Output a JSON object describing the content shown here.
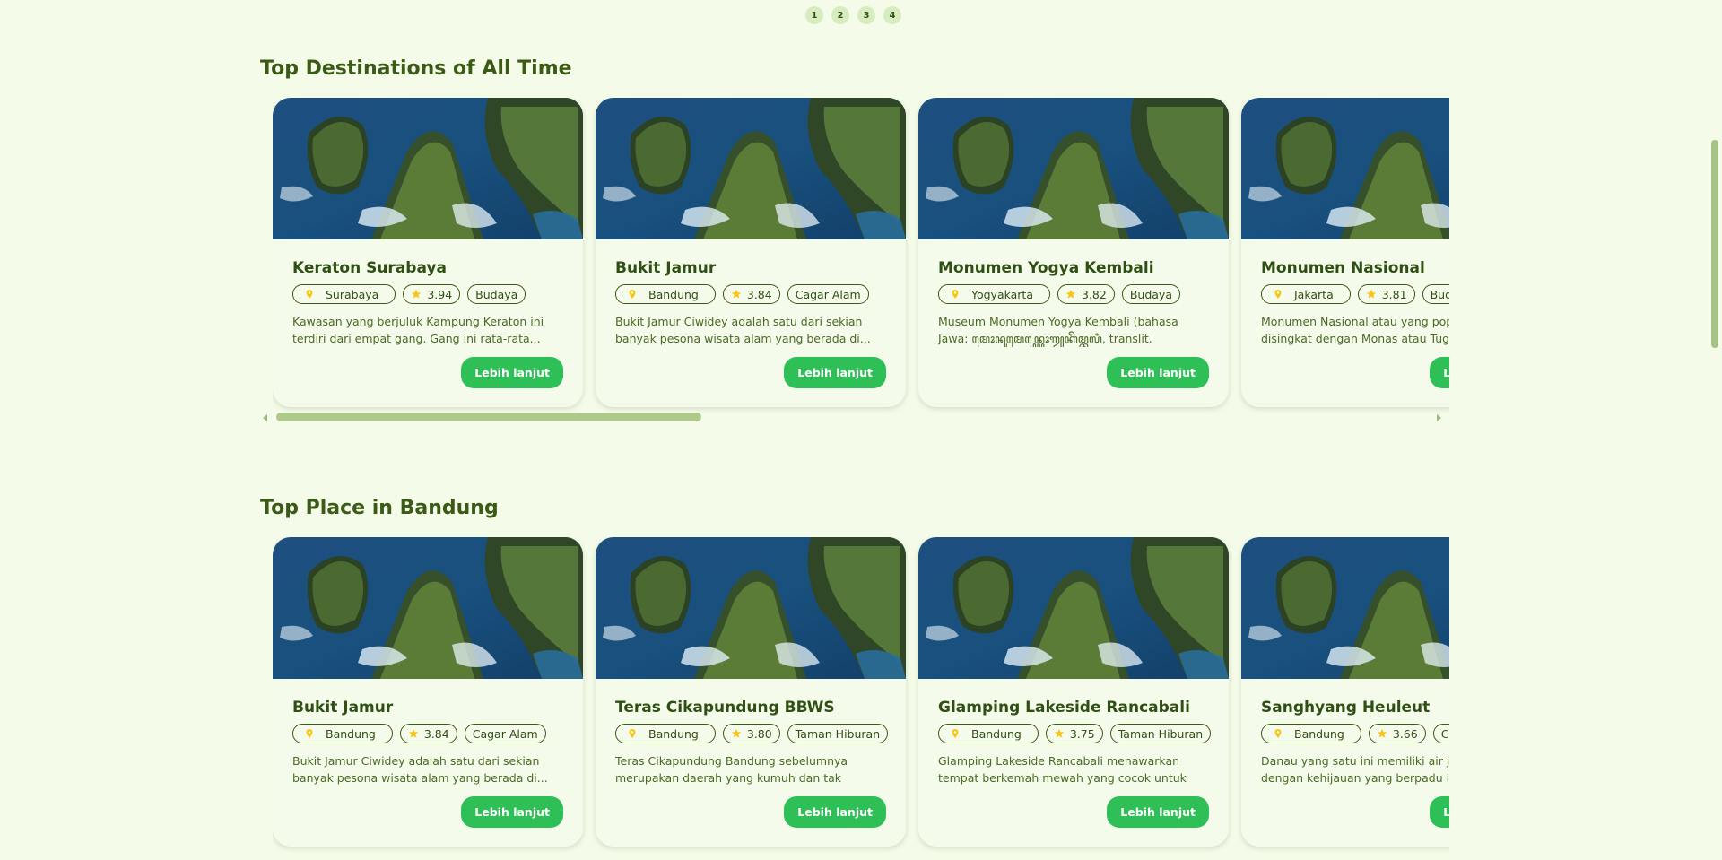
{
  "pagination": [
    "1",
    "2",
    "3",
    "4"
  ],
  "colors": {
    "background": "#f4fbe9",
    "heading": "#3a5a16",
    "button": "#2fbf57",
    "star": "#f5c518",
    "pin": "#f5c518"
  },
  "icons": {
    "location": "map-pin-icon",
    "rating": "star-icon"
  },
  "sections": [
    {
      "title": "Top Destinations of All Time",
      "cards": [
        {
          "name": "Keraton Surabaya",
          "city": "Surabaya",
          "rating": "3.94",
          "category": "Budaya",
          "description": "Kawasan yang berjuluk Kampung Keraton ini terdiri dari empat gang. Gang ini rata-rata...",
          "button": "Lebih lanjut"
        },
        {
          "name": "Bukit Jamur",
          "city": "Bandung",
          "rating": "3.84",
          "category": "Cagar Alam",
          "description": "Bukit Jamur Ciwidey adalah satu dari sekian banyak pesona wisata alam yang berada di...",
          "button": "Lebih lanjut"
        },
        {
          "name": "Monumen Yogya Kembali",
          "city": "Yogyakarta",
          "rating": "3.82",
          "category": "Budaya",
          "description": "Museum Monumen Yogya Kembali (bahasa Jawa: ꦩꦺꦴꦤꦸꦩꦺꦤ꧀ꦪꦺꦴꦒꦾꦏꦼꦩ꧀ꦧꦭꦶ, translit. Monumèn...",
          "button": "Lebih lanjut"
        },
        {
          "name": "Monumen Nasional",
          "city": "Jakarta",
          "rating": "3.81",
          "category": "Budaya",
          "description": "Monumen Nasional atau yang populer disingkat dengan Monas atau Tugu Monas adalah...",
          "button": "Lebih lanjut"
        }
      ]
    },
    {
      "title": "Top Place in Bandung",
      "cards": [
        {
          "name": "Bukit Jamur",
          "city": "Bandung",
          "rating": "3.84",
          "category": "Cagar Alam",
          "description": "Bukit Jamur Ciwidey adalah satu dari sekian banyak pesona wisata alam yang berada di...",
          "button": "Lebih lanjut"
        },
        {
          "name": "Teras Cikapundung BBWS",
          "city": "Bandung",
          "rating": "3.80",
          "category": "Taman Hiburan",
          "description": "Teras Cikapundung Bandung sebelumnya merupakan daerah yang kumuh dan tak terurus...",
          "button": "Lebih lanjut"
        },
        {
          "name": "Glamping Lakeside Rancabali",
          "city": "Bandung",
          "rating": "3.75",
          "category": "Taman Hiburan",
          "description": "Glamping Lakeside Rancabali menawarkan tempat berkemah mewah yang cocok untuk Anda jadika...",
          "button": "Lebih lanjut"
        },
        {
          "name": "Sanghyang Heuleut",
          "city": "Bandung",
          "rating": "3.66",
          "category": "Cagar Alam",
          "description": "Danau yang satu ini memiliki air jernih dengan kehijauan yang berpadu indah dengan...",
          "button": "Lebih lanjut"
        }
      ]
    }
  ]
}
